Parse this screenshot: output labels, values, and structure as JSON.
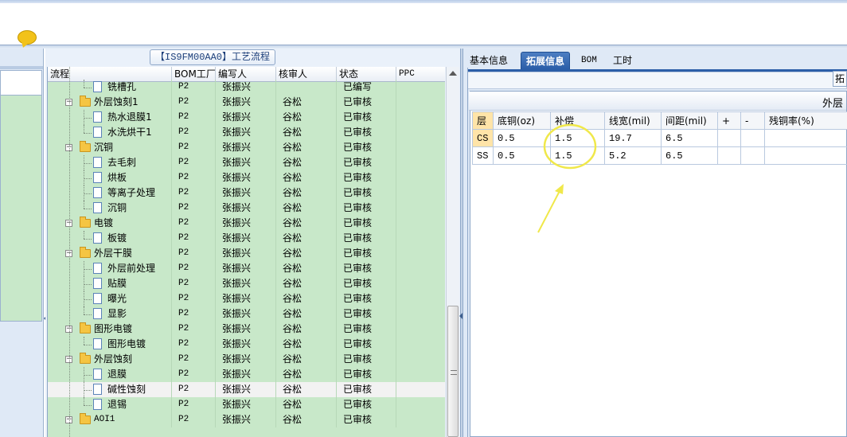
{
  "middle_panel": {
    "title": "【IS9FM00AA0】工艺流程",
    "columns": [
      "流程",
      "BOM工厂",
      "编写人",
      "核审人",
      "状态",
      "PPC"
    ],
    "rows": [
      {
        "name": "铣槽孔",
        "level": 2,
        "type": "doc",
        "bom": "P2",
        "writer": "张振兴",
        "checker": "",
        "status": "已编写",
        "last": true
      },
      {
        "name": "外层蚀刻1",
        "level": 1,
        "type": "folder",
        "bom": "P2",
        "writer": "张振兴",
        "checker": "谷松",
        "status": "已审核"
      },
      {
        "name": "热水退膜1",
        "level": 2,
        "type": "doc",
        "bom": "P2",
        "writer": "张振兴",
        "checker": "谷松",
        "status": "已审核"
      },
      {
        "name": "水洗烘干1",
        "level": 2,
        "type": "doc",
        "bom": "P2",
        "writer": "张振兴",
        "checker": "谷松",
        "status": "已审核",
        "last": true
      },
      {
        "name": "沉铜",
        "level": 1,
        "type": "folder",
        "bom": "P2",
        "writer": "张振兴",
        "checker": "谷松",
        "status": "已审核"
      },
      {
        "name": "去毛刺",
        "level": 2,
        "type": "doc",
        "bom": "P2",
        "writer": "张振兴",
        "checker": "谷松",
        "status": "已审核"
      },
      {
        "name": "烘板",
        "level": 2,
        "type": "doc",
        "bom": "P2",
        "writer": "张振兴",
        "checker": "谷松",
        "status": "已审核"
      },
      {
        "name": "等离子处理",
        "level": 2,
        "type": "doc",
        "bom": "P2",
        "writer": "张振兴",
        "checker": "谷松",
        "status": "已审核"
      },
      {
        "name": "沉铜",
        "level": 2,
        "type": "doc",
        "bom": "P2",
        "writer": "张振兴",
        "checker": "谷松",
        "status": "已审核",
        "last": true
      },
      {
        "name": "电镀",
        "level": 1,
        "type": "folder",
        "bom": "P2",
        "writer": "张振兴",
        "checker": "谷松",
        "status": "已审核"
      },
      {
        "name": "板镀",
        "level": 2,
        "type": "doc",
        "bom": "P2",
        "writer": "张振兴",
        "checker": "谷松",
        "status": "已审核",
        "last": true
      },
      {
        "name": "外层干膜",
        "level": 1,
        "type": "folder",
        "bom": "P2",
        "writer": "张振兴",
        "checker": "谷松",
        "status": "已审核"
      },
      {
        "name": "外层前处理",
        "level": 2,
        "type": "doc",
        "bom": "P2",
        "writer": "张振兴",
        "checker": "谷松",
        "status": "已审核"
      },
      {
        "name": "贴膜",
        "level": 2,
        "type": "doc",
        "bom": "P2",
        "writer": "张振兴",
        "checker": "谷松",
        "status": "已审核"
      },
      {
        "name": "曝光",
        "level": 2,
        "type": "doc",
        "bom": "P2",
        "writer": "张振兴",
        "checker": "谷松",
        "status": "已审核"
      },
      {
        "name": "显影",
        "level": 2,
        "type": "doc",
        "bom": "P2",
        "writer": "张振兴",
        "checker": "谷松",
        "status": "已审核",
        "last": true
      },
      {
        "name": "图形电镀",
        "level": 1,
        "type": "folder",
        "bom": "P2",
        "writer": "张振兴",
        "checker": "谷松",
        "status": "已审核"
      },
      {
        "name": "图形电镀",
        "level": 2,
        "type": "doc",
        "bom": "P2",
        "writer": "张振兴",
        "checker": "谷松",
        "status": "已审核",
        "last": true
      },
      {
        "name": "外层蚀刻",
        "level": 1,
        "type": "folder",
        "bom": "P2",
        "writer": "张振兴",
        "checker": "谷松",
        "status": "已审核"
      },
      {
        "name": "退膜",
        "level": 2,
        "type": "doc",
        "bom": "P2",
        "writer": "张振兴",
        "checker": "谷松",
        "status": "已审核"
      },
      {
        "name": "碱性蚀刻",
        "level": 2,
        "type": "doc",
        "bom": "P2",
        "writer": "张振兴",
        "checker": "谷松",
        "status": "已审核",
        "selected": true
      },
      {
        "name": "退锡",
        "level": 2,
        "type": "doc",
        "bom": "P2",
        "writer": "张振兴",
        "checker": "谷松",
        "status": "已审核",
        "last": true
      },
      {
        "name": "AOI1",
        "level": 1,
        "type": "folder",
        "bom": "P2",
        "writer": "张振兴",
        "checker": "谷松",
        "status": "已审核"
      }
    ]
  },
  "right_panel": {
    "tabs": [
      {
        "label": "基本信息",
        "active": false
      },
      {
        "label": "拓展信息",
        "active": true
      },
      {
        "label": "BOM",
        "active": false
      },
      {
        "label": "工时",
        "active": false
      }
    ],
    "toolbar_button": "拓",
    "group_caption": "外层",
    "table": {
      "headers": [
        "层",
        "底铜(oz)",
        "补偿",
        "线宽(mil)",
        "间距(mil)",
        "+",
        "-",
        "残铜率(%)"
      ],
      "rows": [
        [
          "CS",
          "0.5",
          "1.5",
          "19.7",
          "6.5",
          "",
          "",
          ""
        ],
        [
          "SS",
          "0.5",
          "1.5",
          "5.2",
          "6.5",
          "",
          "",
          ""
        ]
      ]
    }
  },
  "colors": {
    "grid_green": "#c8e8c9",
    "tab_active": "#2b5ea8",
    "annotation_yellow": "#f0e84a"
  }
}
